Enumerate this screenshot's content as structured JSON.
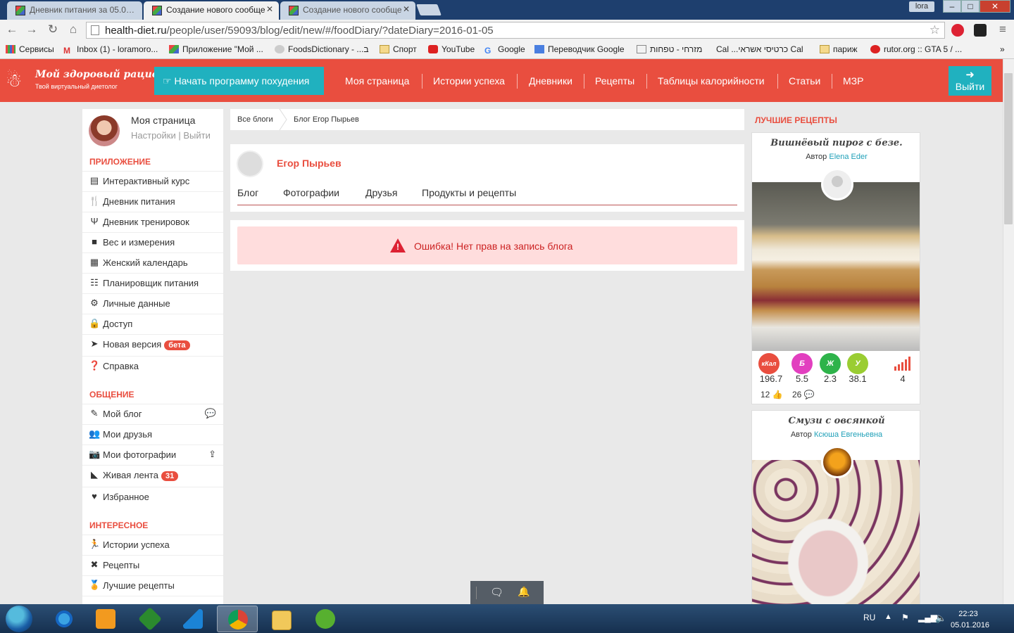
{
  "browser": {
    "tabs": [
      {
        "title": "Дневник питания за 05.0…",
        "active": false
      },
      {
        "title": "Создание нового сообще",
        "active": true
      },
      {
        "title": "Создание нового сообще",
        "active": false
      }
    ],
    "user_chip": "lora",
    "window_buttons": {
      "minimize": "–",
      "maximize": "□",
      "close": "✕"
    },
    "url_host": "health-diet.ru",
    "url_path": "/people/user/59093/blog/edit/new/#/foodDiary/?dateDiary=2016-01-05",
    "bookmarks": [
      {
        "label": "Сервисы",
        "icon": "apps-grid-icon"
      },
      {
        "label": "Inbox (1) - loramoro...",
        "icon": "gmail-icon"
      },
      {
        "label": "Приложение \"Мой ...",
        "icon": "app-favicon-icon"
      },
      {
        "label": "FoodsDictionary - ...ב",
        "icon": "foods-icon"
      },
      {
        "label": "Спорт",
        "icon": "folder-icon"
      },
      {
        "label": "YouTube",
        "icon": "youtube-icon"
      },
      {
        "label": "Google",
        "icon": "google-icon"
      },
      {
        "label": "Переводчик Google",
        "icon": "translate-icon"
      },
      {
        "label": "מזרחי - טפחות",
        "icon": "page-icon"
      },
      {
        "label": "Cal ...כרטיסי אשראי Cal",
        "icon": "cal-icon"
      },
      {
        "label": "париж",
        "icon": "folder-icon"
      },
      {
        "label": "rutor.org :: GTA 5 / ...",
        "icon": "rutor-icon"
      }
    ],
    "bookmarks_more": "»"
  },
  "site": {
    "logo_title": "Мой здоровый рацион",
    "logo_subtitle": "Твой виртуальный диетолог",
    "start_button": "Начать программу похудения",
    "nav": [
      "Моя страница",
      "Истории успеха",
      "Дневники",
      "Рецепты",
      "Таблицы калорийности",
      "Статьи",
      "МЗР"
    ],
    "logout": "Выйти",
    "accent": "#e94e3f",
    "teal": "#20b1bf"
  },
  "sidebar": {
    "my_page": "Моя страница",
    "settings": "Настройки",
    "sep": "|",
    "exit": "Выйти",
    "sections": [
      {
        "title": "ПРИЛОЖЕНИЕ",
        "items": [
          {
            "label": "Интерактивный курс",
            "icon": "course-icon"
          },
          {
            "label": "Дневник питания",
            "icon": "fork-knife-icon"
          },
          {
            "label": "Дневник тренировок",
            "icon": "dumbbell-icon"
          },
          {
            "label": "Вес и измерения",
            "icon": "scale-icon"
          },
          {
            "label": "Женский календарь",
            "icon": "calendar-icon"
          },
          {
            "label": "Планировщик питания",
            "icon": "planner-icon"
          },
          {
            "label": "Личные данные",
            "icon": "personal-data-icon"
          },
          {
            "label": "Доступ",
            "icon": "lock-icon"
          },
          {
            "label": "Новая версия",
            "icon": "paper-plane-icon",
            "badge": "бета"
          },
          {
            "label": "Справка",
            "icon": "question-icon"
          }
        ]
      },
      {
        "title": "ОБЩЕНИЕ",
        "items": [
          {
            "label": "Мой блог",
            "icon": "blog-icon",
            "right_icon": "comments-icon"
          },
          {
            "label": "Мои друзья",
            "icon": "friends-icon"
          },
          {
            "label": "Мои фотографии",
            "icon": "camera-icon",
            "right_icon": "upload-icon"
          },
          {
            "label": "Живая лента",
            "icon": "rss-icon",
            "badge": "31"
          },
          {
            "label": "Избранное",
            "icon": "heart-icon"
          }
        ]
      },
      {
        "title": "ИНТЕРЕСНОЕ",
        "items": [
          {
            "label": "Истории успеха",
            "icon": "runner-icon"
          },
          {
            "label": "Рецепты",
            "icon": "recipes-icon"
          },
          {
            "label": "Лучшие рецепты",
            "icon": "medal-icon"
          }
        ]
      }
    ]
  },
  "breadcrumb": {
    "root": "Все блоги",
    "current": "Блог Егор Пырьев"
  },
  "profile": {
    "name": "Егор Пырьев",
    "tabs": [
      "Блог",
      "Фотографии",
      "Друзья",
      "Продукты и рецепты"
    ]
  },
  "error": {
    "message": "Ошибка! Нет прав на запись блога",
    "color": "#cc2222"
  },
  "right": {
    "heading": "ЛУЧШИЕ РЕЦЕПТЫ",
    "author_prefix": "Автор",
    "recipes": [
      {
        "title": "Вишнёвый пирог с безе.",
        "author": "Elena Eder",
        "nutrients": [
          {
            "label": "кКал",
            "value": "196.7",
            "color": "#e94e3f"
          },
          {
            "label": "Б",
            "value": "5.5",
            "color": "#e23fbf"
          },
          {
            "label": "Ж",
            "value": "2.3",
            "color": "#2eb34a"
          },
          {
            "label": "У",
            "value": "38.1",
            "color": "#9acd32"
          }
        ],
        "difficulty": "4",
        "likes": "12",
        "comments": "26"
      },
      {
        "title": "Смузи с овсянкой",
        "author": "Ксюша Евгеньевна"
      }
    ]
  },
  "taskbar": {
    "lang": "RU",
    "time": "22:23",
    "date": "05.01.2016"
  }
}
